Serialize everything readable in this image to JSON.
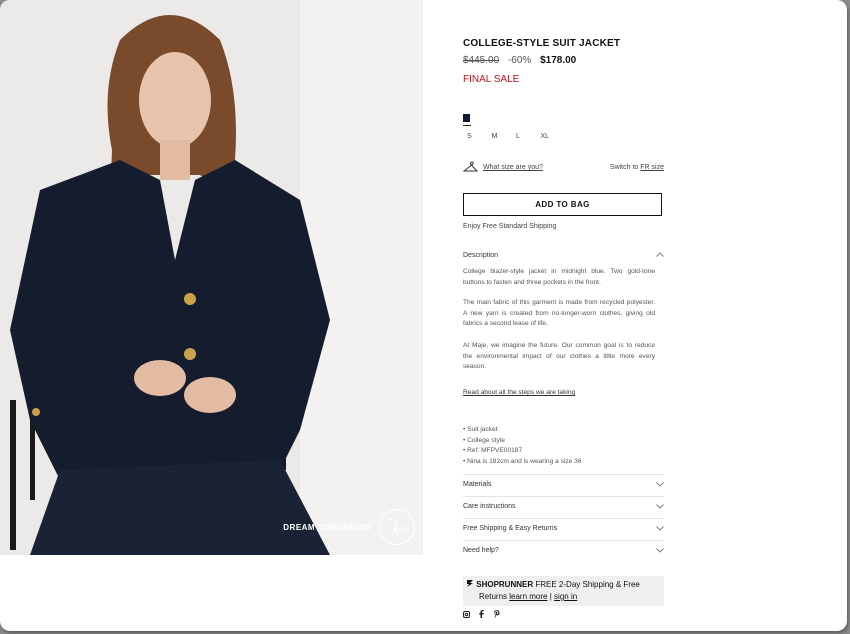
{
  "product": {
    "title": "COLLEGE-STYLE SUIT JACKET",
    "old_price": "$445.00",
    "discount": "-60%",
    "new_price": "$178.00",
    "final_sale": "FINAL SALE",
    "selected_color": "#0f1a33",
    "sizes": [
      "S",
      "M",
      "L",
      "XL"
    ]
  },
  "size_guide": {
    "link": "What size are you?",
    "switch_prefix": "Switch to",
    "switch_link": "FR size"
  },
  "cart": {
    "add_label": "ADD TO BAG",
    "shipping_note": "Enjoy Free Standard Shipping"
  },
  "description": {
    "heading": "Description",
    "paragraphs": [
      "College blazer-style jacket in midnight blue. Two gold-tone buttons to fasten and three pockets in the front.",
      "The main fabric of this garment is made from recycled polyester. A new yarn is created from no-longer-worn clothes, giving old fabrics a second lease of life.",
      "At Maje, we imagine the future. Our common goal is to reduce the environmental impact of our clothes a little more every season."
    ],
    "read_more": "Read about all the steps we are taking",
    "bullets": [
      "• Suit jacket",
      "• College style",
      "• Ref: MFPVE00187",
      "• Nina is 182cm and is wearing a size 36"
    ]
  },
  "accordions": [
    "Materials",
    "Care instructions",
    "Free Shipping & Easy Returns",
    "Need help?"
  ],
  "shoprunner": {
    "brand": "SHOPRUNNER",
    "offer": "FREE 2-Day Shipping & Free",
    "returns": "Returns",
    "learn_more": "learn more",
    "separator": "|",
    "sign_in": "sign in"
  },
  "photo": {
    "badge": "DREAM TOMORROW"
  },
  "icons": [
    "hanger-icon",
    "chevron-up-icon",
    "chevron-down-icon",
    "shoprunner-icon",
    "instagram-icon",
    "facebook-icon",
    "pinterest-icon",
    "globe-icon"
  ]
}
